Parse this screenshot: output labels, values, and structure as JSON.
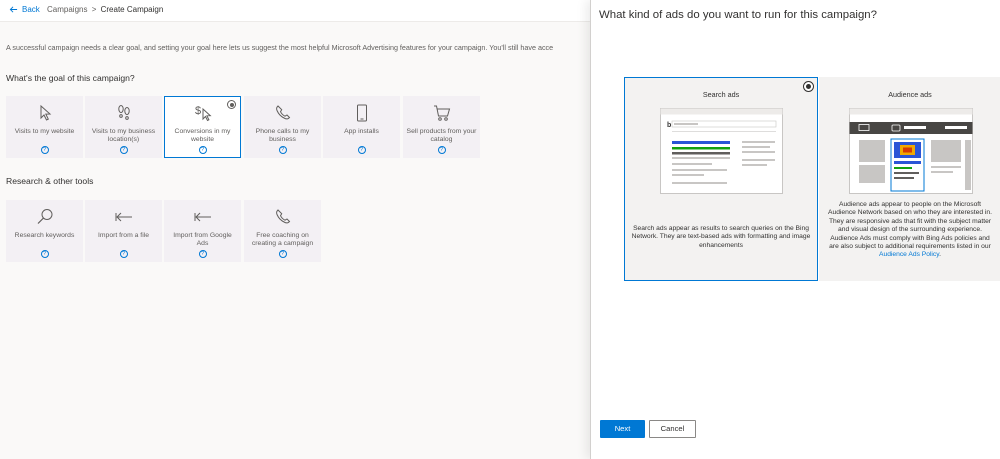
{
  "breadcrumb": {
    "back_label": "Back",
    "items": [
      "Campaigns",
      "Create Campaign"
    ],
    "separator": ">"
  },
  "intro_text": "A successful campaign needs a clear goal, and setting your goal here lets us suggest the most helpful Microsoft Advertising features for your campaign. You'll still have acce",
  "goal_section": {
    "title": "What's the goal of this campaign?",
    "tiles": [
      {
        "label": "Visits to my website",
        "icon": "cursor-icon",
        "selected": false
      },
      {
        "label": "Visits to my business location(s)",
        "icon": "footprints-icon",
        "selected": false
      },
      {
        "label": "Conversions in my website",
        "icon": "dollar-cursor-icon",
        "selected": true
      },
      {
        "label": "Phone calls to my business",
        "icon": "phone-icon",
        "selected": false
      },
      {
        "label": "App installs",
        "icon": "mobile-device-icon",
        "selected": false
      },
      {
        "label": "Sell products from your catalog",
        "icon": "shopping-cart-icon",
        "selected": false
      }
    ]
  },
  "tools_section": {
    "title": "Research & other tools",
    "tiles": [
      {
        "label": "Research keywords",
        "icon": "search-icon"
      },
      {
        "label": "Import from a file",
        "icon": "import-arrow-icon"
      },
      {
        "label": "Import from Google Ads",
        "icon": "import-arrow-icon"
      },
      {
        "label": "Free coaching on creating a campaign",
        "icon": "phone-icon"
      }
    ]
  },
  "help_glyph": "?",
  "panel": {
    "title": "What kind of ads do you want to run for this campaign?",
    "cards": [
      {
        "name": "Search ads",
        "selected": true,
        "description": "Search ads appear as results to search queries on the Bing Network. They are text-based ads with formatting and image enhancements"
      },
      {
        "name": "Audience ads",
        "selected": false,
        "description": "Audience ads appear to people on the Microsoft Audience Network based on who they are interested in. They are responsive ads that fit with the subject matter and visual design of the surrounding experience. Audience Ads must comply with Bing Ads policies and are also subject to additional requirements listed in our",
        "link_text": "Audience Ads Policy",
        "after_link": "."
      }
    ],
    "next_label": "Next",
    "cancel_label": "Cancel"
  },
  "colors": {
    "accent": "#0078d4",
    "tile_bg": "#f3f0f4",
    "card_bg": "#f3f2f1"
  }
}
